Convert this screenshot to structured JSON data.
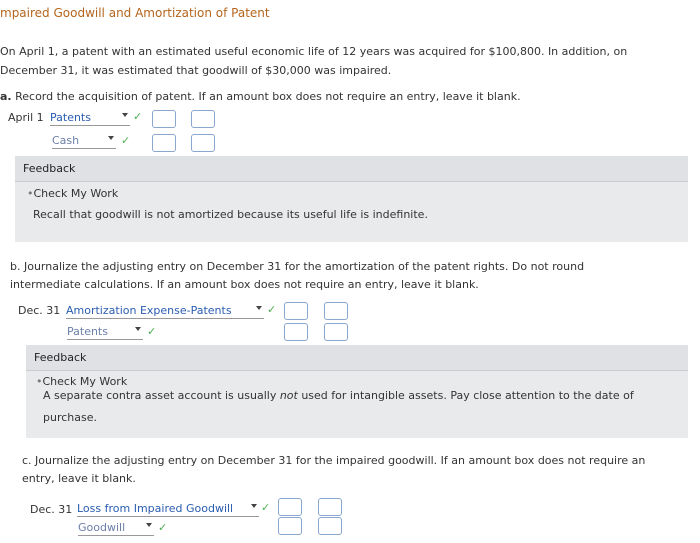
{
  "title": "mpaired Goodwill and Amortization of Patent",
  "intro": {
    "line1": "On April 1, a patent with an estimated useful economic life of 12 years was acquired for $100,800. In addition, on",
    "line2": "December 31, it was estimated that goodwill of $30,000 was impaired."
  },
  "part_a": {
    "prefix": "a.",
    "question": "Record the acquisition of patent. If an amount box does not require an entry, leave it blank.",
    "date": "April 1",
    "debit_account": "Patents",
    "credit_account": "Cash",
    "feedback": {
      "header": "Feedback",
      "check_label": "Check My Work",
      "text": "Recall that goodwill is not amortized because its useful life is indefinite."
    }
  },
  "part_b": {
    "question_line1": "b. Journalize the adjusting entry on December 31 for the amortization of the patent rights. Do not round",
    "question_line2": "intermediate calculations. If an amount box does not require an entry, leave it blank.",
    "date": "Dec. 31",
    "debit_account": "Amortization Expense-Patents",
    "credit_account": "Patents",
    "feedback": {
      "header": "Feedback",
      "check_label": "Check My Work",
      "text_before": "A separate contra asset account is usually ",
      "text_emph": "not",
      "text_after": " used for intangible assets. Pay close attention to the date of",
      "text_line2": "purchase."
    }
  },
  "part_c": {
    "question_line1": "c. Journalize the adjusting entry on December 31 for the impaired goodwill. If an amount box does not require an",
    "question_line2": "entry, leave it blank.",
    "date": "Dec. 31",
    "debit_account": "Loss from Impaired Goodwill",
    "credit_account": "Goodwill"
  },
  "check_mark": "✓",
  "colors": {
    "title": "#b5651d",
    "check": "#4caf50",
    "link": "#2a5db0",
    "feedback_bg": "#e9eaec"
  }
}
